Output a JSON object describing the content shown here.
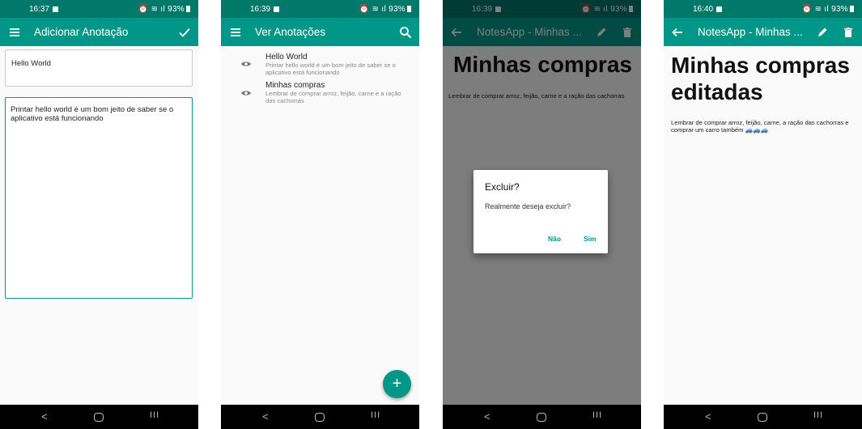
{
  "status": [
    {
      "time": "16:37",
      "battery": "93%"
    },
    {
      "time": "16:39",
      "battery": "93%"
    },
    {
      "time": "16:39",
      "battery": "93%"
    },
    {
      "time": "16:40",
      "battery": "93%"
    }
  ],
  "screen1": {
    "title": "Adicionar Anotação",
    "title_value": "Hello World",
    "body_value": "Printar hello world é um bom jeito de saber se o aplicativo está funcionando"
  },
  "screen2": {
    "title": "Ver Anotações",
    "notes": [
      {
        "title": "Hello World",
        "body": "Printar hello world é um bom jeito de saber se o aplicativo está funcionando"
      },
      {
        "title": "Minhas compras",
        "body": "Lembrar de comprar arroz, feijão, carne e a ração das cachorras"
      }
    ],
    "fab": "+"
  },
  "screen3": {
    "title": "NotesApp - Minhas ...",
    "note_title": "Minhas compras",
    "note_body": "Lembrar de comprar arroz, feijão, carne e a ração das cachorras",
    "dialog": {
      "title": "Excluir?",
      "message": "Realmente deseja excluir?",
      "no": "Não",
      "yes": "Sim"
    }
  },
  "screen4": {
    "title": "NotesApp - Minhas ...",
    "note_title": "Minhas compras editadas",
    "note_body": "Lembrar de comprar arroz, feijão, carne, a ração das cachorras e comprar um carro também 🚙🚙🚙"
  },
  "colors": {
    "primary": "#009688",
    "primary_dark": "#00796b"
  }
}
